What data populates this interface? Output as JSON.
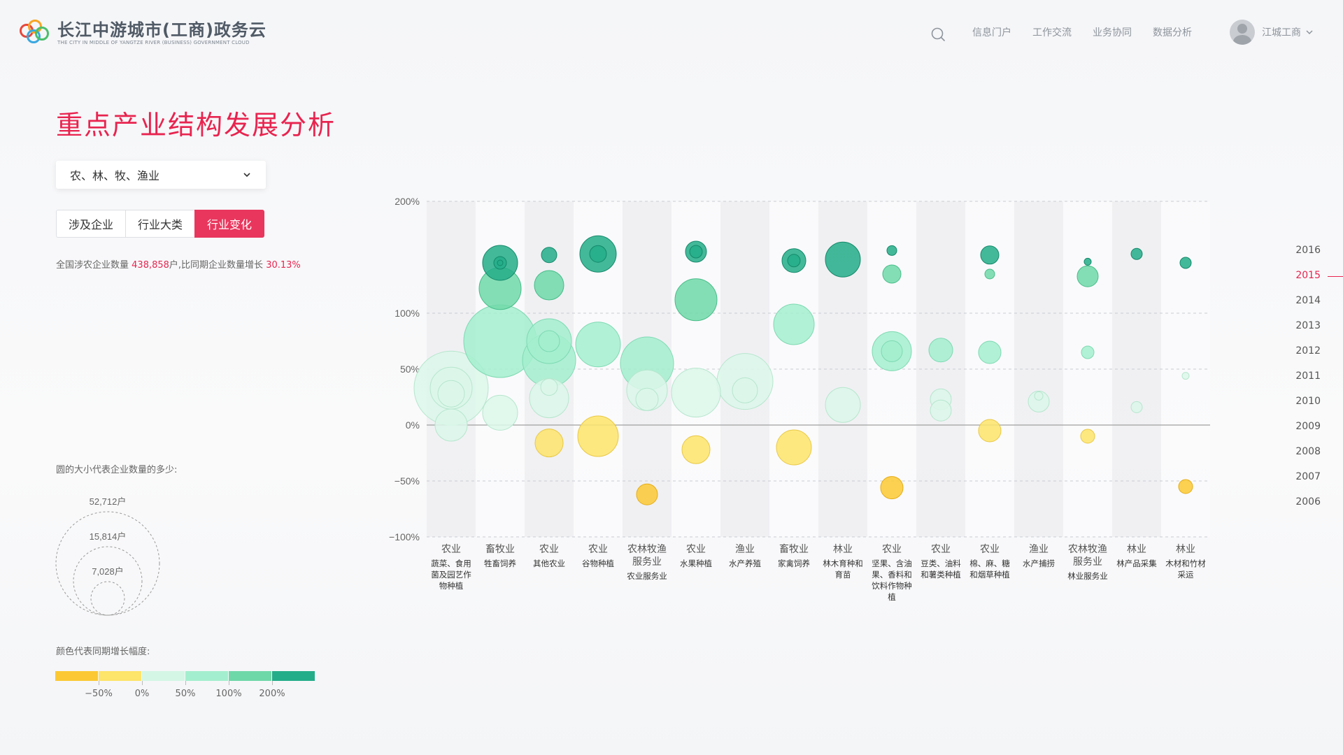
{
  "header": {
    "logo_title": "长江中游城市(工商)政务云",
    "logo_sub": "THE CITY IN MIDDLE OF YANGTZE RIVER (BUSINESS) GOVERNMENT CLOUD",
    "nav": [
      "信息门户",
      "工作交流",
      "业务协同",
      "数据分析"
    ],
    "user_name": "江城工商"
  },
  "page": {
    "title": "重点产业结构发展分析",
    "select_value": "农、林、牧、渔业",
    "tabs": [
      "涉及企业",
      "行业大类",
      "行业变化"
    ],
    "active_tab": 2,
    "summary_prefix": "全国涉农企业数量",
    "summary_count": "438,858",
    "summary_mid": "户,比同期企业数量增长",
    "summary_pct": "30.13%"
  },
  "legend": {
    "size_title": "圆的大小代表企业数量的多少:",
    "size_labels": [
      "52,712户",
      "15,814户",
      "7,028户"
    ],
    "color_title": "颜色代表同期增长幅度:",
    "colors": [
      "#fcc934",
      "#fde46a",
      "#d4f6e5",
      "#a3eece",
      "#6fd8a8",
      "#23ad88"
    ],
    "color_labels": [
      "−50%",
      "0%",
      "50%",
      "100%",
      "200%"
    ]
  },
  "years": {
    "items": [
      "2016",
      "2015",
      "2014",
      "2013",
      "2012",
      "2011",
      "2010",
      "2009",
      "2008",
      "2007",
      "2006"
    ],
    "active": "2015"
  },
  "chart_data": {
    "type": "scatter",
    "y_ticks": [
      "200%",
      "100%",
      "50%",
      "0%",
      "−50%",
      "−100%"
    ],
    "y_tick_values": [
      200,
      100,
      50,
      0,
      -50,
      -100
    ],
    "categories": [
      {
        "group": "农业",
        "name": "蔬菜、食用菌及园艺作物种植"
      },
      {
        "group": "畜牧业",
        "name": "牲畜饲养"
      },
      {
        "group": "农业",
        "name": "其他农业"
      },
      {
        "group": "农业",
        "name": "谷物种植"
      },
      {
        "group": "农林牧渔服务业",
        "name": "农业服务业"
      },
      {
        "group": "农业",
        "name": "水果种植"
      },
      {
        "group": "渔业",
        "name": "水产养殖"
      },
      {
        "group": "畜牧业",
        "name": "家禽饲养"
      },
      {
        "group": "林业",
        "name": "林木育种和育苗"
      },
      {
        "group": "农业",
        "name": "坚果、含油果、香料和饮料作物种植"
      },
      {
        "group": "农业",
        "name": "豆类、油料和薯类种植"
      },
      {
        "group": "农业",
        "name": "棉、麻、糖和烟草种植"
      },
      {
        "group": "渔业",
        "name": "水产捕捞"
      },
      {
        "group": "农林牧渔服务业",
        "name": "林业服务业"
      },
      {
        "group": "林业",
        "name": "林产品采集"
      },
      {
        "group": "林业",
        "name": "木材和竹材采运"
      }
    ],
    "bubbles": [
      {
        "c": 0,
        "y": 33,
        "r": 53
      },
      {
        "c": 0,
        "y": 33,
        "r": 30
      },
      {
        "c": 0,
        "y": 28,
        "r": 19
      },
      {
        "c": 0,
        "y": 0,
        "r": 23
      },
      {
        "c": 1,
        "y": 145,
        "r": 25
      },
      {
        "c": 1,
        "y": 145,
        "r": 9
      },
      {
        "c": 1,
        "y": 145,
        "r": 4
      },
      {
        "c": 1,
        "y": 122,
        "r": 30
      },
      {
        "c": 1,
        "y": 75,
        "r": 52
      },
      {
        "c": 1,
        "y": 11,
        "r": 25
      },
      {
        "c": 2,
        "y": 152,
        "r": 11
      },
      {
        "c": 2,
        "y": 125,
        "r": 21
      },
      {
        "c": 2,
        "y": 58,
        "r": 38
      },
      {
        "c": 2,
        "y": 75,
        "r": 32
      },
      {
        "c": 2,
        "y": 75,
        "r": 15
      },
      {
        "c": 2,
        "y": 24,
        "r": 28
      },
      {
        "c": 2,
        "y": 34,
        "r": 12
      },
      {
        "c": 2,
        "y": -16,
        "r": 20
      },
      {
        "c": 3,
        "y": 153,
        "r": 26
      },
      {
        "c": 3,
        "y": 153,
        "r": 12
      },
      {
        "c": 3,
        "y": 72,
        "r": 32
      },
      {
        "c": 3,
        "y": -10,
        "r": 29
      },
      {
        "c": 4,
        "y": 55,
        "r": 38
      },
      {
        "c": 4,
        "y": 31,
        "r": 29
      },
      {
        "c": 4,
        "y": 23,
        "r": 16
      },
      {
        "c": 4,
        "y": -62,
        "r": 15
      },
      {
        "c": 5,
        "y": 155,
        "r": 15
      },
      {
        "c": 5,
        "y": 155,
        "r": 9
      },
      {
        "c": 5,
        "y": 112,
        "r": 30
      },
      {
        "c": 5,
        "y": 29,
        "r": 35
      },
      {
        "c": 5,
        "y": -22,
        "r": 20
      },
      {
        "c": 6,
        "y": 39,
        "r": 40
      },
      {
        "c": 6,
        "y": 31,
        "r": 18
      },
      {
        "c": 7,
        "y": 147,
        "r": 17
      },
      {
        "c": 7,
        "y": 147,
        "r": 9
      },
      {
        "c": 7,
        "y": 90,
        "r": 29
      },
      {
        "c": 7,
        "y": -20,
        "r": 25
      },
      {
        "c": 8,
        "y": 148,
        "r": 25
      },
      {
        "c": 8,
        "y": 18,
        "r": 25
      },
      {
        "c": 9,
        "y": 156,
        "r": 7
      },
      {
        "c": 9,
        "y": 135,
        "r": 13
      },
      {
        "c": 9,
        "y": 66,
        "r": 28
      },
      {
        "c": 9,
        "y": 66,
        "r": 15
      },
      {
        "c": 9,
        "y": -56,
        "r": 16
      },
      {
        "c": 10,
        "y": 67,
        "r": 17
      },
      {
        "c": 10,
        "y": 23,
        "r": 15
      },
      {
        "c": 10,
        "y": 13,
        "r": 15
      },
      {
        "c": 11,
        "y": 152,
        "r": 13
      },
      {
        "c": 11,
        "y": 135,
        "r": 7
      },
      {
        "c": 11,
        "y": 65,
        "r": 16
      },
      {
        "c": 11,
        "y": -5,
        "r": 16
      },
      {
        "c": 12,
        "y": 21,
        "r": 15
      },
      {
        "c": 12,
        "y": 26,
        "r": 6
      },
      {
        "c": 13,
        "y": 146,
        "r": 5
      },
      {
        "c": 13,
        "y": 133,
        "r": 15
      },
      {
        "c": 13,
        "y": 65,
        "r": 9
      },
      {
        "c": 13,
        "y": -10,
        "r": 10
      },
      {
        "c": 14,
        "y": 153,
        "r": 8
      },
      {
        "c": 14,
        "y": 16,
        "r": 8
      },
      {
        "c": 15,
        "y": 145,
        "r": 8
      },
      {
        "c": 15,
        "y": 44,
        "r": 5
      },
      {
        "c": 15,
        "y": -55,
        "r": 10
      }
    ]
  }
}
